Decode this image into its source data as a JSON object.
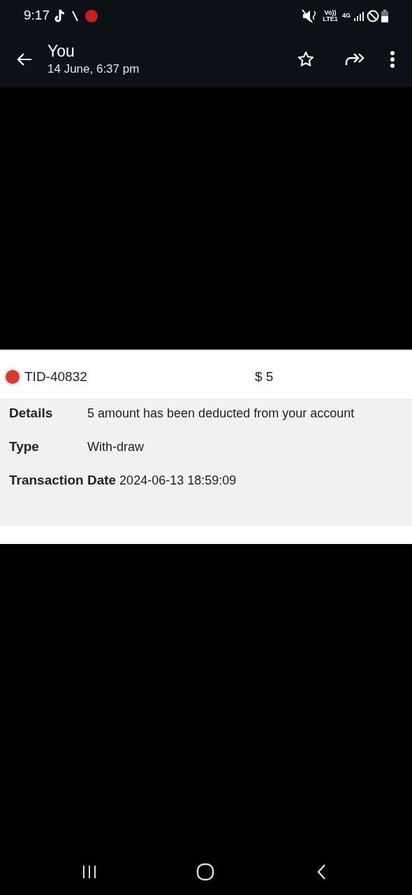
{
  "status_bar": {
    "time": "9:17",
    "network_label": "Vo)) LTE1",
    "network_type": "4G"
  },
  "header": {
    "title": "You",
    "subtitle": "14 June, 6:37 pm"
  },
  "transaction": {
    "id": "TID-40832",
    "amount": "$ 5",
    "fields": [
      {
        "label": "Details",
        "value": "5 amount has been deducted from your account"
      },
      {
        "label": "Type",
        "value": "With-draw"
      },
      {
        "label": "Transaction Date",
        "value": "2024-06-13 18:59:09"
      }
    ]
  }
}
